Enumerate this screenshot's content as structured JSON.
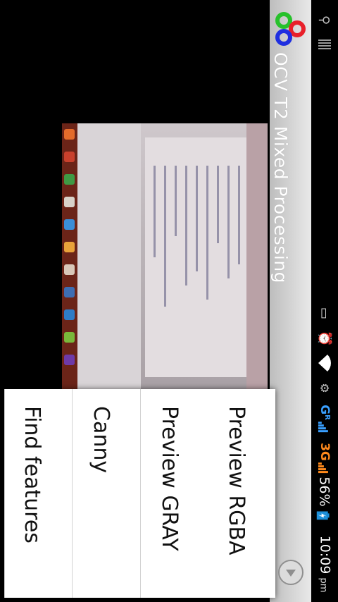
{
  "status_bar": {
    "usb_icon": "usb-icon",
    "menu_icon": "overflow-icon",
    "rotate_icon": "screen-rotation-icon",
    "alarm_icon": "alarm-icon",
    "wifi_icon": "wifi-icon",
    "debug_icon": "usb-debugging-icon",
    "net1": {
      "label": "G",
      "sup": "R"
    },
    "net2": {
      "label": "3G"
    },
    "battery": {
      "percent": "56%"
    },
    "time": {
      "value": "10:09",
      "ampm": "pm"
    }
  },
  "action_bar": {
    "title": "OCV T2 Mixed Processing",
    "logo": "opencv-logo",
    "logo_colors": [
      "#e8202a",
      "#27c12b",
      "#1f2fe0"
    ]
  },
  "menu": {
    "items": [
      {
        "label": "Preview RGBA"
      },
      {
        "label": "Preview GRAY"
      },
      {
        "label": "Canny"
      },
      {
        "label": "Find features"
      }
    ]
  },
  "navigation": {
    "back_icon": "back-arrow-icon"
  }
}
